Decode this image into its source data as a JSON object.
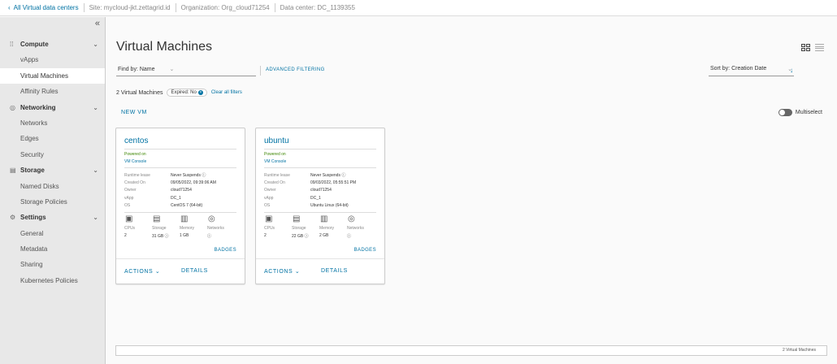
{
  "topbar": {
    "back_label": "All Virtual data centers",
    "site": "Site: mycloud-jkt.zettagrid.id",
    "organization": "Organization: Org_cloud71254",
    "datacenter": "Data center: DC_1139355"
  },
  "sidebar": {
    "collapse_icon": "double-chevron-left-icon",
    "groups": [
      {
        "label": "Compute",
        "icon": "grid-icon",
        "items": [
          "vApps",
          "Virtual Machines",
          "Affinity Rules"
        ]
      },
      {
        "label": "Networking",
        "icon": "network-icon",
        "items": [
          "Networks",
          "Edges",
          "Security"
        ]
      },
      {
        "label": "Storage",
        "icon": "storage-icon",
        "items": [
          "Named Disks",
          "Storage Policies"
        ]
      },
      {
        "label": "Settings",
        "icon": "gear-icon",
        "items": [
          "General",
          "Metadata",
          "Sharing",
          "Kubernetes Policies"
        ]
      }
    ],
    "active_item": "Virtual Machines"
  },
  "main": {
    "title": "Virtual Machines",
    "find_by": "Find by: Name",
    "advanced_filtering": "ADVANCED FILTERING",
    "sort_by": "Sort by: Creation Date",
    "count": "2 Virtual Machines",
    "filter_chip": "Expired: No",
    "clear_filters": "Clear all filters",
    "new_vm": "NEW VM",
    "multiselect": "Multiselect",
    "footer": "2 Virtual Machines"
  },
  "cards": [
    {
      "name": "centos",
      "status": "Powered on",
      "console": "VM Console",
      "props": [
        {
          "k": "Runtime lease",
          "v": "Never Suspends ⓘ"
        },
        {
          "k": "Created On",
          "v": "09/05/2022, 09:39:06 AM"
        },
        {
          "k": "Owner",
          "v": "cloud71254"
        },
        {
          "k": "vApp",
          "v": "DC_1"
        },
        {
          "k": "OS",
          "v": "CentOS 7 (64-bit)"
        }
      ],
      "stats": [
        {
          "lbl": "CPUs",
          "val": "2"
        },
        {
          "lbl": "Storage",
          "val": "31 GB ⓘ"
        },
        {
          "lbl": "Memory",
          "val": "1 GB"
        },
        {
          "lbl": "Networks",
          "val": "ⓘ"
        }
      ],
      "badges": "BADGES",
      "actions": "ACTIONS ⌄",
      "details": "DETAILS"
    },
    {
      "name": "ubuntu",
      "status": "Powered on",
      "console": "VM Console",
      "props": [
        {
          "k": "Runtime lease",
          "v": "Never Suspends ⓘ"
        },
        {
          "k": "Created On",
          "v": "09/03/2022, 05:55:51 PM"
        },
        {
          "k": "Owner",
          "v": "cloud71254"
        },
        {
          "k": "vApp",
          "v": "DC_1"
        },
        {
          "k": "OS",
          "v": "Ubuntu Linux (64-bit)"
        }
      ],
      "stats": [
        {
          "lbl": "CPUs",
          "val": "2"
        },
        {
          "lbl": "Storage",
          "val": "22 GB ⓘ"
        },
        {
          "lbl": "Memory",
          "val": "2 GB"
        },
        {
          "lbl": "Networks",
          "val": "ⓘ"
        }
      ],
      "badges": "BADGES",
      "actions": "ACTIONS ⌄",
      "details": "DETAILS"
    }
  ],
  "colors": {
    "link": "#0072a3",
    "powered_on": "#3c8500",
    "sidebar_bg": "#e8e8e8"
  }
}
